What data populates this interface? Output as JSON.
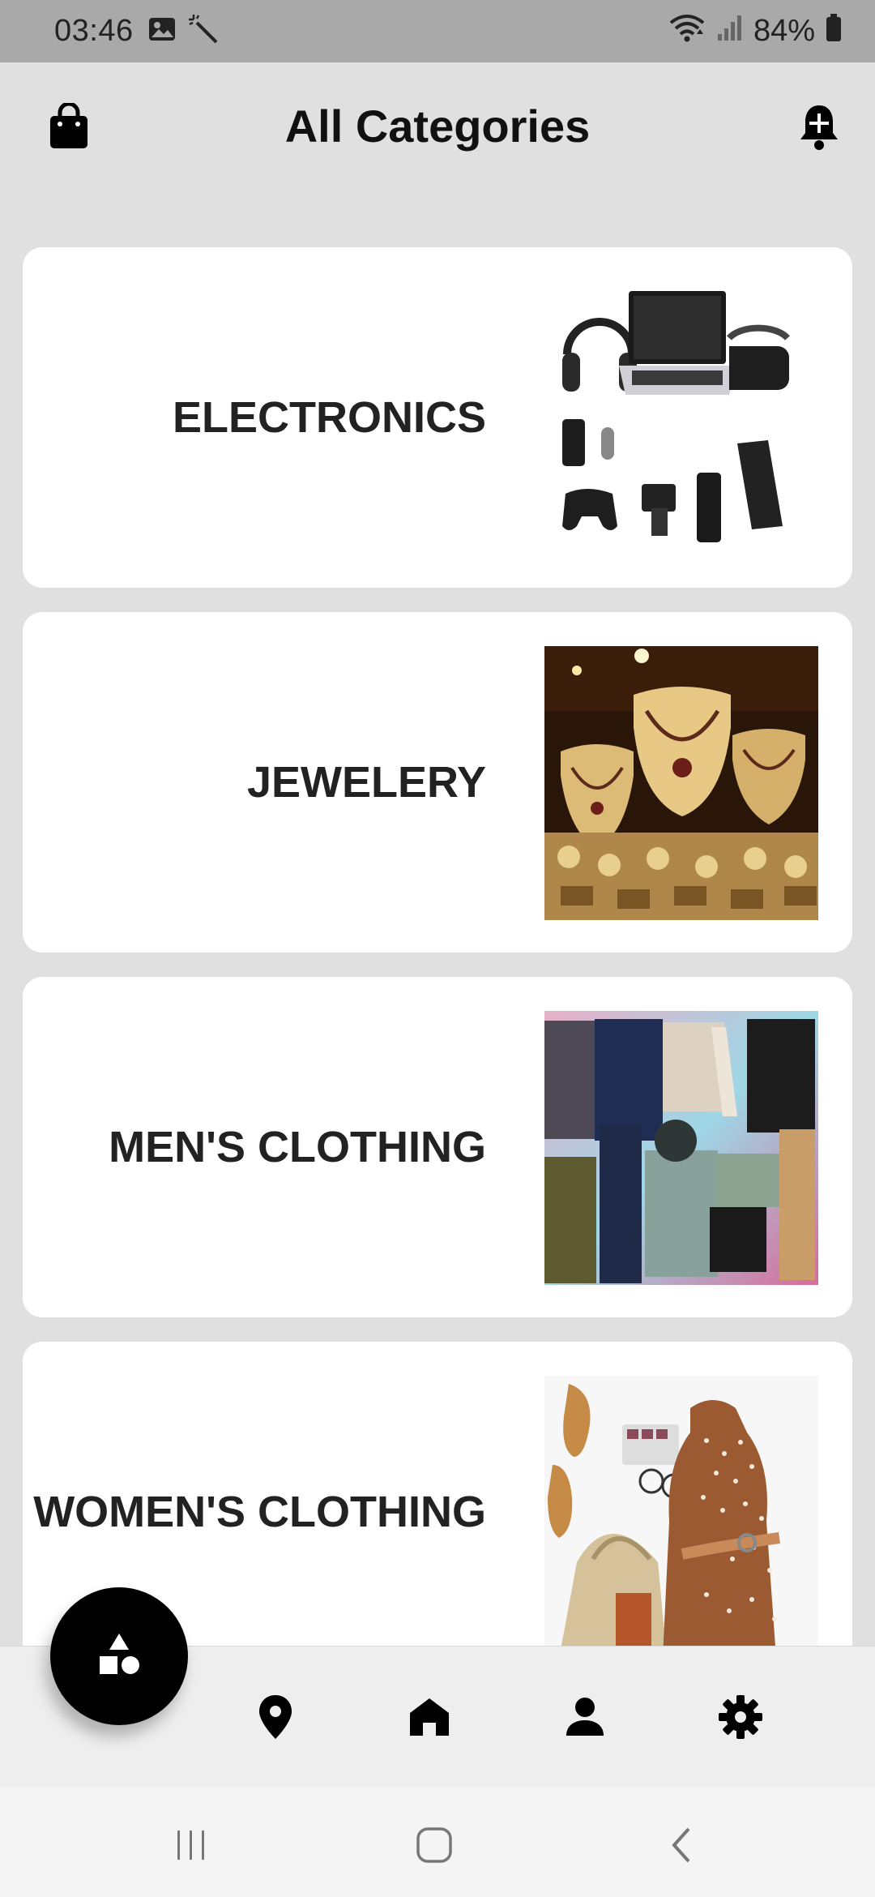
{
  "status_bar": {
    "time": "03:46",
    "battery": "84%"
  },
  "header": {
    "title": "All Categories"
  },
  "categories": [
    {
      "label": "ELECTRONICS",
      "image": "electronics-photo"
    },
    {
      "label": "JEWELERY",
      "image": "jewelery-photo"
    },
    {
      "label": "MEN'S CLOTHING",
      "image": "mens-clothing-photo"
    },
    {
      "label": "WOMEN'S CLOTHING",
      "image": "womens-clothing-photo"
    }
  ],
  "bottom_nav": {
    "items": [
      {
        "icon": "location-pin-icon"
      },
      {
        "icon": "home-icon"
      },
      {
        "icon": "person-icon"
      },
      {
        "icon": "gear-icon"
      }
    ],
    "fab_icon": "shapes-icon"
  },
  "colors": {
    "status_bar_bg": "#a9a9a9",
    "page_bg": "#e0e0e0",
    "card_bg": "#ffffff",
    "fab_bg": "#000000"
  }
}
